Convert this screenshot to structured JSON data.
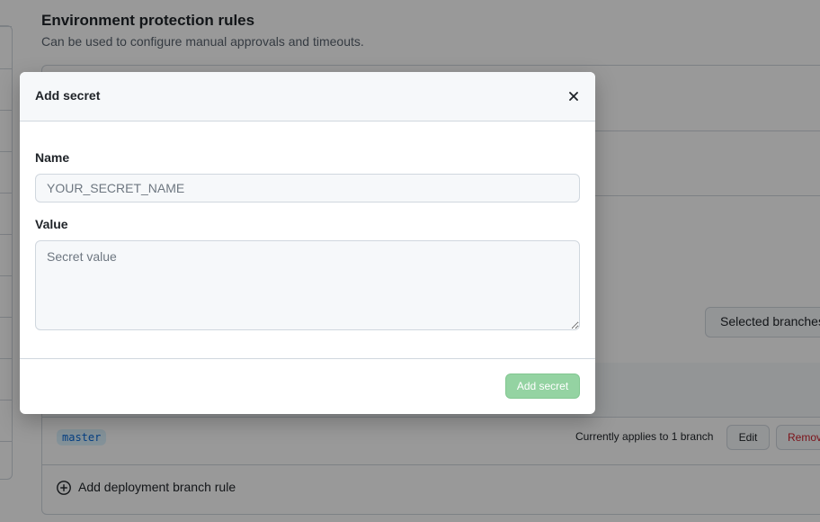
{
  "background": {
    "section_title": "Environment protection rules",
    "section_subtitle": "Can be used to configure manual approvals and timeouts.",
    "branch_select_label": "Selected branches",
    "branch_rule": {
      "tag": "master",
      "applies_text": "Currently applies to 1 branch",
      "edit_label": "Edit",
      "remove_label": "Remove"
    },
    "add_rule_label": "Add deployment branch rule",
    "add_rule_icon": "plus-circle-icon"
  },
  "modal": {
    "title": "Add secret",
    "close_icon": "close-icon",
    "name_label": "Name",
    "name_placeholder": "YOUR_SECRET_NAME",
    "name_value": "",
    "value_label": "Value",
    "value_placeholder": "Secret value",
    "value_value": "",
    "submit_label": "Add secret",
    "submit_disabled": true,
    "submit_color": "#94d3a2"
  },
  "colors": {
    "overlay": "rgba(0,0,0,0.40)",
    "danger": "#cf222e",
    "branch_tag_bg": "#ddf4ff"
  }
}
